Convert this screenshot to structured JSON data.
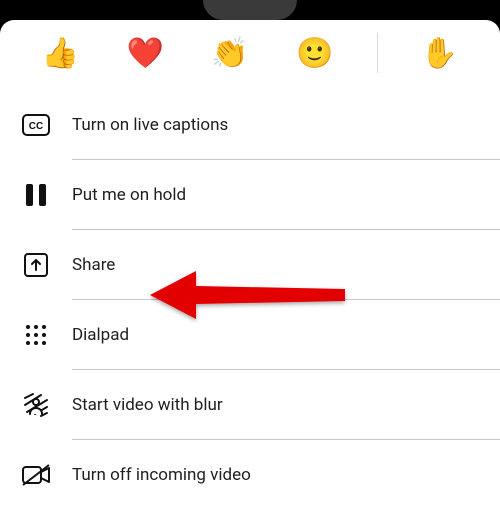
{
  "reactions": {
    "like": "👍",
    "love": "❤️",
    "clap": "👏",
    "smile": "🙂",
    "raise": "✋"
  },
  "menu": {
    "captions": {
      "label": "Turn on live captions"
    },
    "hold": {
      "label": "Put me on hold"
    },
    "share": {
      "label": "Share"
    },
    "dialpad": {
      "label": "Dialpad"
    },
    "blur": {
      "label": "Start video with blur"
    },
    "incoming": {
      "label": "Turn off incoming video"
    }
  }
}
